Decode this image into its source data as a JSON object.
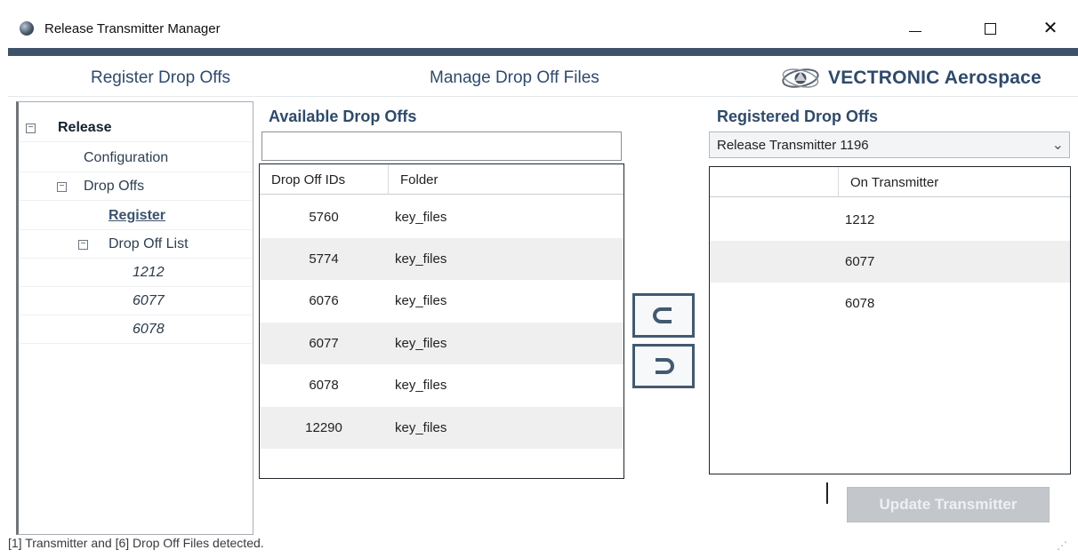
{
  "window": {
    "title": "Release Transmitter Manager",
    "minimize_glyph": "minimize-icon",
    "maximize_glyph": "maximize-icon",
    "close_label": "✕"
  },
  "tabs": {
    "register": "Register Drop Offs",
    "manage": "Manage Drop Off Files"
  },
  "brand": {
    "name": "VECTRONIC Aerospace",
    "icon": "vectronic-logo-icon"
  },
  "tree": {
    "root": "Release",
    "configuration": "Configuration",
    "drop_offs": "Drop Offs",
    "register": "Register",
    "drop_off_list": "Drop Off List",
    "items": [
      "1212",
      "6077",
      "6078"
    ],
    "expander_glyph": "−"
  },
  "available": {
    "heading": "Available Drop Offs",
    "search_value": "",
    "columns": [
      "Drop Off IDs",
      "Folder"
    ],
    "rows": [
      {
        "id": "5760",
        "folder": "key_files"
      },
      {
        "id": "5774",
        "folder": "key_files"
      },
      {
        "id": "6076",
        "folder": "key_files"
      },
      {
        "id": "6077",
        "folder": "key_files"
      },
      {
        "id": "6078",
        "folder": "key_files"
      },
      {
        "id": "12290",
        "folder": "key_files"
      }
    ]
  },
  "registered": {
    "heading": "Registered Drop Offs",
    "selected_transmitter": "Release Transmitter 1196",
    "columns": [
      "",
      "On Transmitter"
    ],
    "rows": [
      "1212",
      "6077",
      "6078"
    ]
  },
  "transfer": {
    "add_icon": "move-right-icon",
    "remove_icon": "move-left-icon"
  },
  "update_button": "Update Transmitter",
  "status": "[1] Transmitter and [6] Drop Off Files detected.",
  "colors": {
    "accent": "#3d5168",
    "heading": "#2f4a6b",
    "disabled_button": "#c3c7cb",
    "alt_row": "#efefef"
  }
}
